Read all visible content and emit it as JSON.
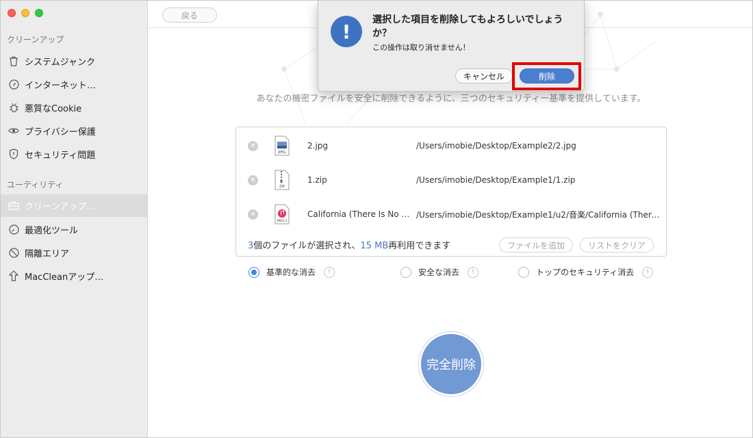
{
  "sidebar": {
    "sections": [
      {
        "title": "クリーンアップ",
        "items": [
          {
            "label": "システムジャンク",
            "icon": "trash-icon"
          },
          {
            "label": "インターネット…",
            "icon": "compass-icon"
          },
          {
            "label": "悪質なCookie",
            "icon": "bug-icon"
          },
          {
            "label": "プライバシー保護",
            "icon": "eye-icon"
          },
          {
            "label": "セキュリティ問題",
            "icon": "shield-icon"
          }
        ]
      },
      {
        "title": "ユーティリティ",
        "items": [
          {
            "label": "クリーンアップ…",
            "icon": "briefcase-icon",
            "active": true
          },
          {
            "label": "最適化ツール",
            "icon": "speed-icon"
          },
          {
            "label": "隔離エリア",
            "icon": "quarantine-icon"
          },
          {
            "label": "MacCleanアップ…",
            "icon": "upload-arrow-icon"
          }
        ]
      }
    ]
  },
  "toolbar": {
    "back_label": "戻る"
  },
  "main": {
    "description": "あなたの機密ファイルを安全に削除できるように、三つのセキュリティー基準を提供しています。",
    "files": [
      {
        "name": "2.jpg",
        "path": "/Users/imobie/Desktop/Example2/2.jpg",
        "type": "JPEG"
      },
      {
        "name": "1.zip",
        "path": "/Users/imobie/Desktop/Example1/1.zip",
        "type": "ZIP"
      },
      {
        "name": "California (There Is No End…",
        "path": "/Users/imobie/Desktop/Example1/u2/音楽/California (There Is No…",
        "type": "MPEG 4"
      }
    ],
    "summary": {
      "count": "3",
      "text1": "個のファイルが選択され、",
      "size": "15 MB",
      "text2": "再利用できます"
    },
    "add_files_label": "ファイルを追加",
    "clear_list_label": "リストをクリア",
    "options": [
      {
        "label": "基準的な消去",
        "selected": true
      },
      {
        "label": "安全な消去",
        "selected": false
      },
      {
        "label": "トップのセキュリティ消去",
        "selected": false
      }
    ],
    "erase_button_label": "完全削除"
  },
  "dialog": {
    "title": "選択した項目を削除してもよろしいでしょうか？",
    "message": "この操作は取り消せません！",
    "cancel_label": "キャンセル",
    "delete_label": "削除"
  },
  "colors": {
    "accent": "#3d87e0",
    "dialog_button": "#4a7fd0",
    "erase_button": "#7199d4",
    "highlight": "#e00000"
  }
}
